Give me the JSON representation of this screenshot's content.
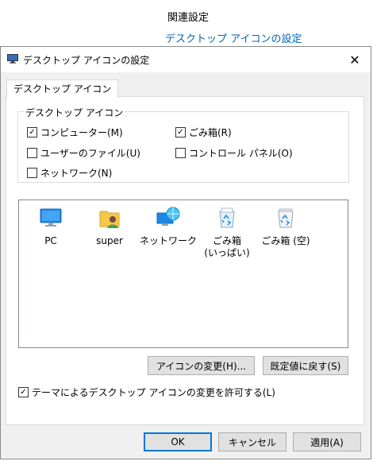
{
  "background": {
    "header": "関連設定",
    "link": "デスクトップ アイコンの設定"
  },
  "dialog": {
    "title": "デスクトップ アイコンの設定",
    "close_icon": "close-icon",
    "tab_label": "デスクトップ アイコン",
    "group_title": "デスクトップ アイコン",
    "checkboxes": [
      {
        "label": "コンピューター(M)",
        "checked": true
      },
      {
        "label": "ごみ箱(R)",
        "checked": true
      },
      {
        "label": "ユーザーのファイル(U)",
        "checked": false
      },
      {
        "label": "コントロール パネル(O)",
        "checked": false
      },
      {
        "label": "ネットワーク(N)",
        "checked": false
      }
    ],
    "icons": [
      {
        "label": "PC",
        "icon": "pc-icon"
      },
      {
        "label": "super",
        "icon": "user-folder-icon"
      },
      {
        "label": "ネットワーク",
        "icon": "network-icon"
      },
      {
        "label": "ごみ箱\n(いっぱい)",
        "icon": "recycle-bin-full-icon"
      },
      {
        "label": "ごみ箱 (空)",
        "icon": "recycle-bin-empty-icon"
      }
    ],
    "change_icon_button": "アイコンの変更(H)...",
    "restore_default_button": "既定値に戻す(S)",
    "theme_checkbox": {
      "label": "テーマによるデスクトップ アイコンの変更を許可する(L)",
      "checked": true
    },
    "ok_button": "OK",
    "cancel_button": "キャンセル",
    "apply_button": "適用(A)"
  },
  "colors": {
    "link": "#0066b4",
    "accent": "#0078d7",
    "dialog_bg": "#f0f0f0"
  }
}
